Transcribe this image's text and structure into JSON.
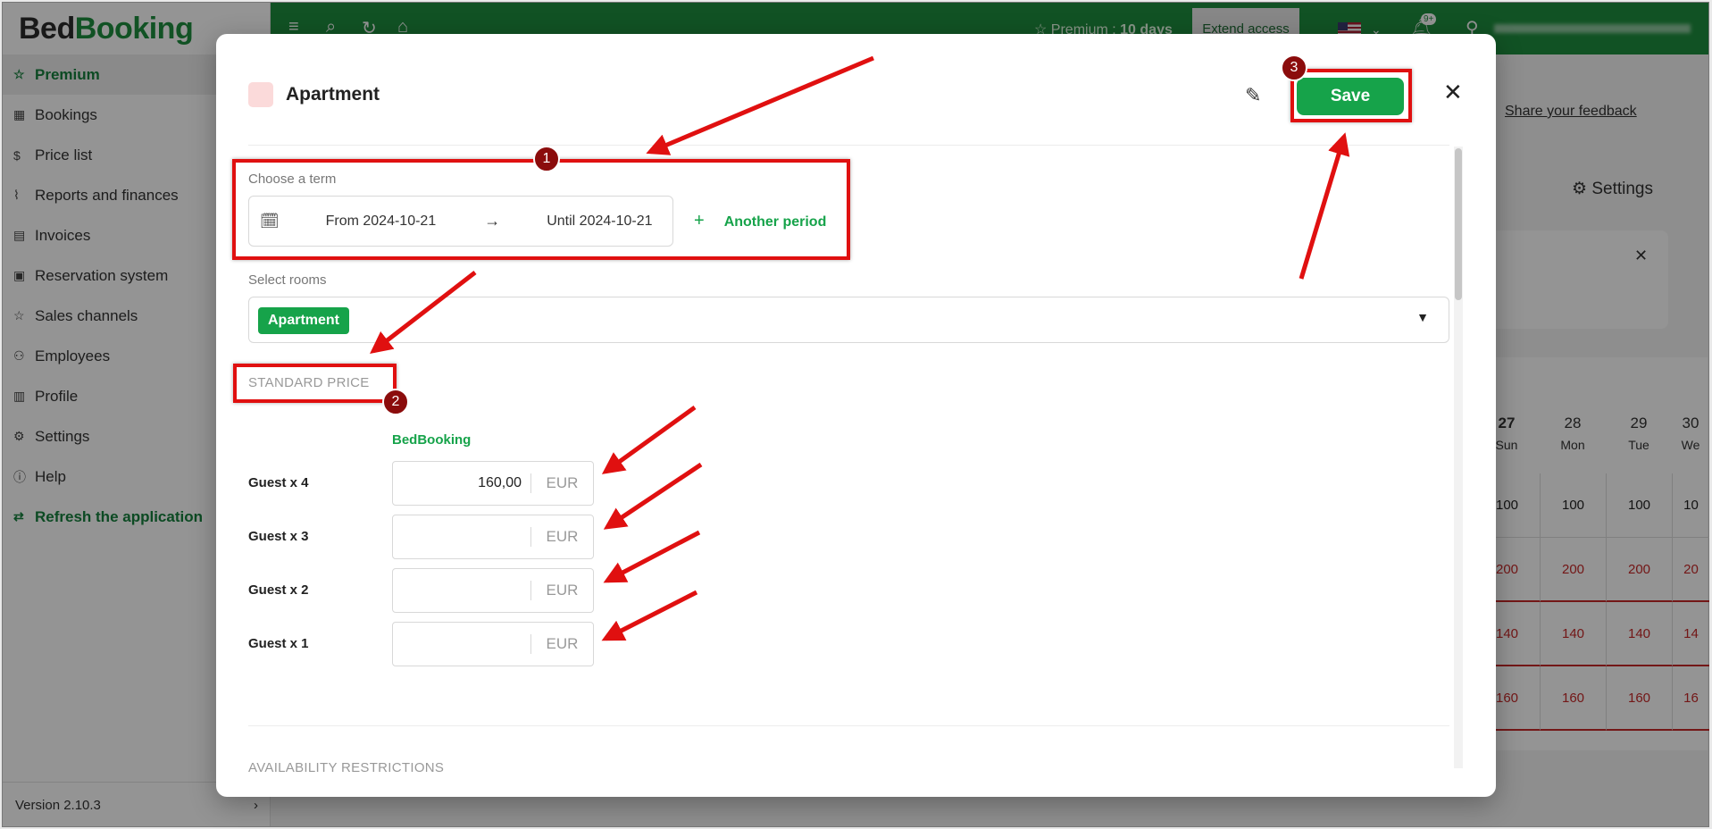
{
  "app": {
    "logo": {
      "part1": "Bed",
      "part2": "Booking"
    },
    "sidebar": {
      "items": [
        {
          "label": "Premium",
          "icon": "star-icon"
        },
        {
          "label": "Bookings",
          "icon": "calendar-icon"
        },
        {
          "label": "Price list",
          "icon": "dollar-icon"
        },
        {
          "label": "Reports and finances",
          "icon": "chart-icon"
        },
        {
          "label": "Invoices",
          "icon": "invoice-icon"
        },
        {
          "label": "Reservation system",
          "icon": "grid-icon"
        },
        {
          "label": "Sales channels",
          "icon": "star-icon"
        },
        {
          "label": "Employees",
          "icon": "user-add-icon"
        },
        {
          "label": "Profile",
          "icon": "building-icon"
        },
        {
          "label": "Settings",
          "icon": "gear-icon"
        },
        {
          "label": "Help",
          "icon": "info-icon"
        },
        {
          "label": "Refresh the application",
          "icon": "refresh-icon"
        }
      ],
      "version": "Version 2.10.3"
    },
    "topbar": {
      "premium_label": "Premium :",
      "premium_days": "10 days",
      "extend_label": "Extend access",
      "notifications_badge": "9+"
    },
    "background": {
      "feedback_link": "Share your feedback",
      "settings_label": "Settings",
      "calendar_days": [
        {
          "num": "27",
          "name": "Sun"
        },
        {
          "num": "28",
          "name": "Mon"
        },
        {
          "num": "29",
          "name": "Tue"
        },
        {
          "num": "30",
          "name": "We"
        }
      ],
      "rows": [
        [
          "100",
          "100",
          "100",
          "10"
        ],
        [
          "200",
          "200",
          "200",
          "20"
        ],
        [
          "140",
          "140",
          "140",
          "14"
        ],
        [
          "160",
          "160",
          "160",
          "16"
        ]
      ]
    }
  },
  "modal": {
    "title": "Apartment",
    "save_label": "Save",
    "choose_term_label": "Choose a term",
    "from_label": "From 2024-10-21",
    "until_label": "Until 2024-10-21",
    "another_period_label": "Another period",
    "select_rooms_label": "Select rooms",
    "selected_room": "Apartment",
    "standard_price_header": "STANDARD PRICE",
    "price_column_header": "BedBooking",
    "guests": [
      {
        "label": "Guest x 4",
        "value": "160,00",
        "currency": "EUR"
      },
      {
        "label": "Guest x 3",
        "value": "",
        "currency": "EUR"
      },
      {
        "label": "Guest x 2",
        "value": "",
        "currency": "EUR"
      },
      {
        "label": "Guest x 1",
        "value": "",
        "currency": "EUR"
      }
    ],
    "availability_header": "AVAILABILITY RESTRICTIONS"
  },
  "annotations": {
    "badges": [
      "1",
      "2",
      "3"
    ],
    "color": "#e01010"
  }
}
